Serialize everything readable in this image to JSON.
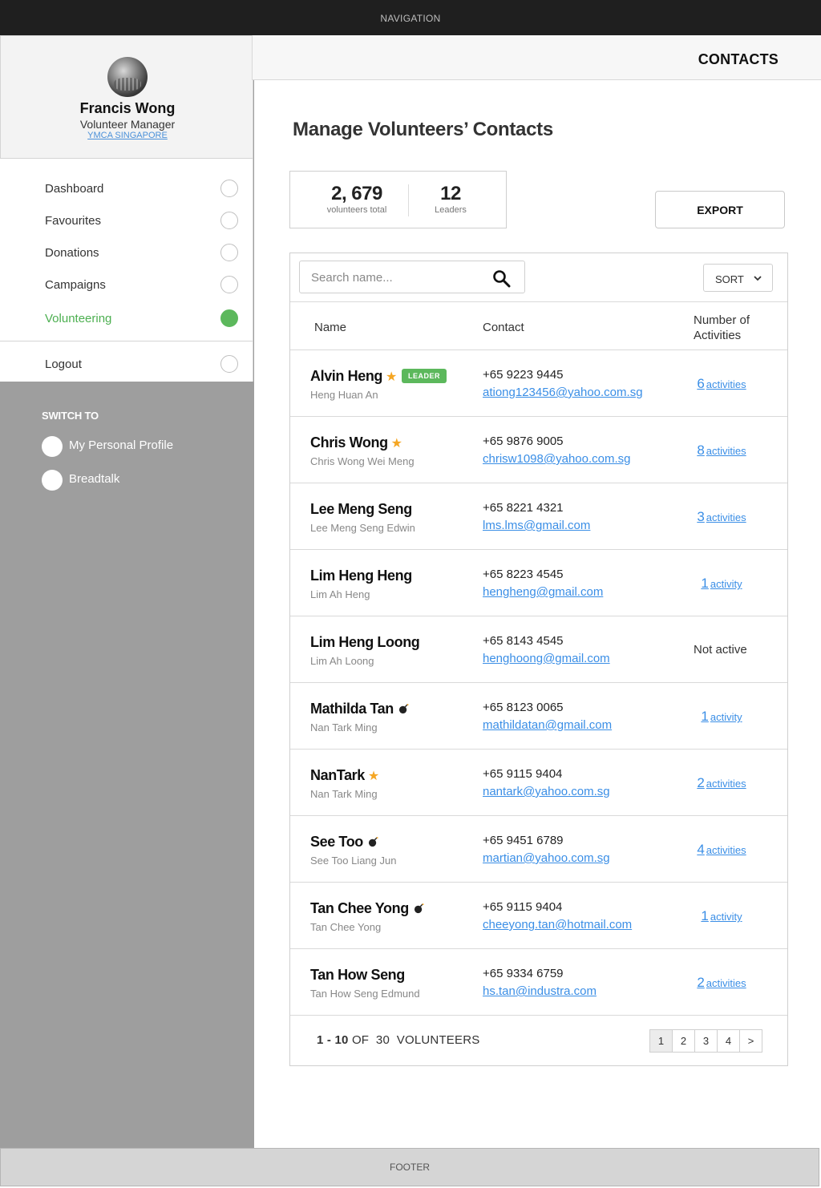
{
  "nav": {
    "label": "NAVIGATION"
  },
  "profile": {
    "name": "Francis Wong",
    "role": "Volunteer Manager",
    "org": "YMCA SINGAPORE"
  },
  "menu": [
    {
      "label": "Dashboard",
      "active": false
    },
    {
      "label": "Favourites",
      "active": false
    },
    {
      "label": "Donations",
      "active": false
    },
    {
      "label": "Campaigns",
      "active": false
    },
    {
      "label": "Volunteering",
      "active": true
    }
  ],
  "logout": {
    "label": "Logout"
  },
  "switch": {
    "title": "SWITCH TO",
    "items": [
      {
        "label": "My Personal Profile"
      },
      {
        "label": "Breadtalk"
      }
    ]
  },
  "header": {
    "title": "CONTACTS"
  },
  "page": {
    "title": "Manage Volunteers’ Contacts"
  },
  "stats": {
    "total_value": "2, 679",
    "total_caption": "volunteers total",
    "leaders_value": "12",
    "leaders_caption": "Leaders"
  },
  "export": {
    "label": "EXPORT"
  },
  "search": {
    "placeholder": "Search name..."
  },
  "sort": {
    "label": "SORT"
  },
  "table": {
    "headers": {
      "name": "Name",
      "contact": "Contact",
      "activities": "Number of Activities"
    },
    "rows": [
      {
        "name": "Alvin Heng",
        "alias": "Heng Huan An",
        "phone": "+65 9223 9445",
        "email": "ationg123456@yahoo.com.sg",
        "count": "6",
        "word": "activities",
        "badge": "star",
        "leader": "LEADER"
      },
      {
        "name": "Chris Wong",
        "alias": "Chris Wong Wei Meng",
        "phone": "+65 9876 9005",
        "email": "chrisw1098@yahoo.com.sg",
        "count": "8",
        "word": "activities",
        "badge": "star"
      },
      {
        "name": "Lee Meng Seng",
        "alias": "Lee Meng Seng Edwin",
        "phone": "+65 8221 4321",
        "email": "lms.lms@gmail.com",
        "count": "3",
        "word": "activities"
      },
      {
        "name": "Lim Heng Heng",
        "alias": "Lim Ah Heng",
        "phone": "+65 8223 4545",
        "email": "hengheng@gmail.com",
        "count": "1",
        "word": "activity"
      },
      {
        "name": "Lim Heng Loong",
        "alias": "Lim Ah Loong",
        "phone": "+65 8143 4545",
        "email": "henghoong@gmail.com",
        "status": "Not active"
      },
      {
        "name": "Mathilda Tan",
        "alias": "Nan Tark Ming",
        "phone": "+65 8123 0065",
        "email": "mathildatan@gmail.com",
        "count": "1",
        "word": "activity",
        "badge": "bomb"
      },
      {
        "name": "NanTark",
        "alias": "Nan Tark Ming",
        "phone": "+65 9115 9404",
        "email": "nantark@yahoo.com.sg",
        "count": "2",
        "word": "activities",
        "badge": "star"
      },
      {
        "name": "See Too",
        "alias": "See Too Liang Jun",
        "phone": "+65 9451 6789",
        "email": "martian@yahoo.com.sg",
        "count": "4",
        "word": "activities",
        "badge": "bomb"
      },
      {
        "name": "Tan Chee Yong",
        "alias": "Tan Chee Yong",
        "phone": "+65 9115 9404",
        "email": "cheeyong.tan@hotmail.com",
        "count": "1",
        "word": "activity",
        "badge": "bomb"
      },
      {
        "name": "Tan How Seng",
        "alias": "Tan How Seng Edmund",
        "phone": "+65 9334 6759",
        "email": "hs.tan@industra.com",
        "count": "2",
        "word": "activities"
      }
    ]
  },
  "pagination": {
    "range": "1 - 10",
    "of": "OF",
    "total": "30",
    "unit": "VOLUNTEERS",
    "pages": [
      "1",
      "2",
      "3",
      "4",
      ">"
    ],
    "current": "1"
  },
  "footer": {
    "label": "FOOTER"
  },
  "colors": {
    "accent_green": "#5cb85c",
    "link_blue": "#3a8ee6",
    "star": "#f5a623"
  }
}
